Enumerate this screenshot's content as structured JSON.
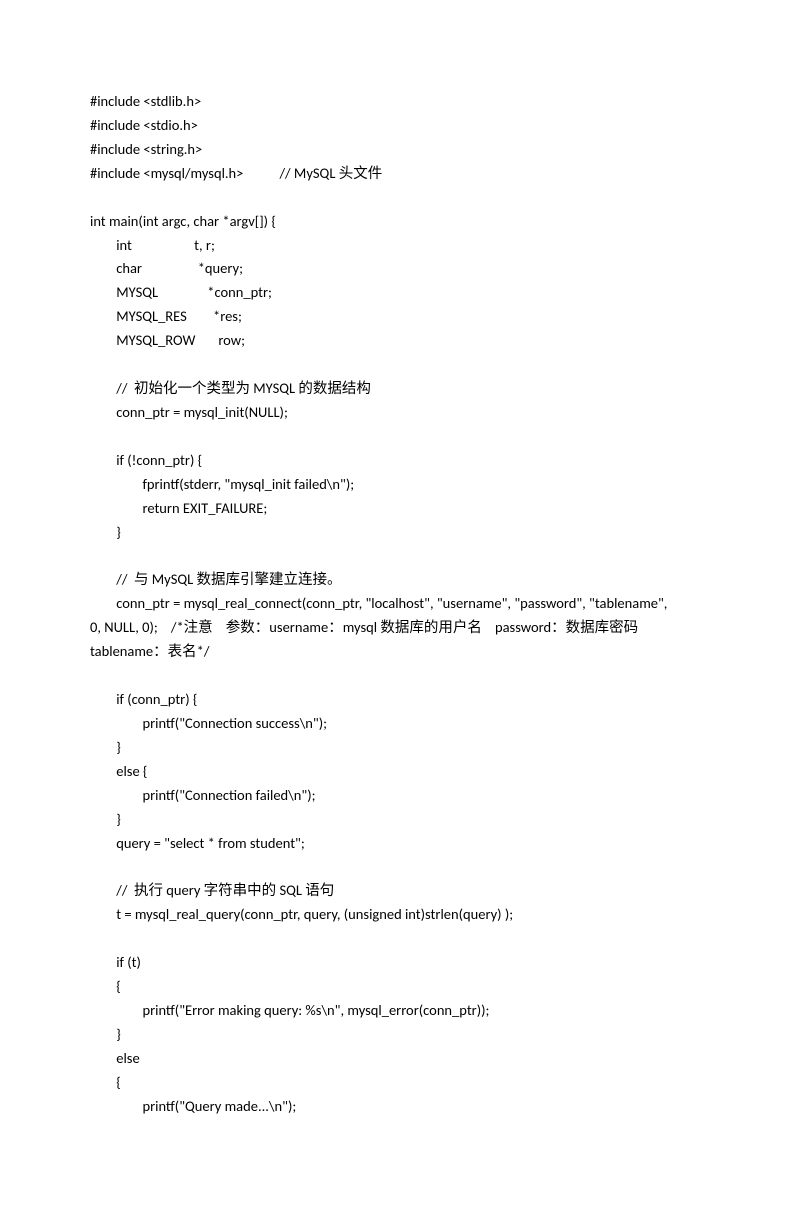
{
  "lines": [
    "#include <stdlib.h>",
    "#include <stdio.h>",
    "#include <string.h>",
    "#include <mysql/mysql.h>           // MySQL 头文件",
    "",
    "int main(int argc, char *argv[]) {",
    "        int                   t, r;",
    "        char                 *query;",
    "        MYSQL               *conn_ptr;",
    "        MYSQL_RES        *res;",
    "        MYSQL_ROW       row;",
    "",
    "        //  初始化一个类型为 MYSQL 的数据结构",
    "        conn_ptr = mysql_init(NULL);",
    "",
    "        if (!conn_ptr) {",
    "                fprintf(stderr, \"mysql_init failed\\n\");",
    "                return EXIT_FAILURE;",
    "        }",
    "",
    "        //  与 MySQL 数据库引擎建立连接。",
    "        conn_ptr = mysql_real_connect(conn_ptr, \"localhost\", \"username\", \"password\", \"tablename\",",
    "0, NULL, 0);    /*注意    参数：username：mysql 数据库的用户名    password：数据库密码",
    "tablename：表名*/",
    "",
    "        if (conn_ptr) {",
    "                printf(\"Connection success\\n\");",
    "        }",
    "        else {",
    "                printf(\"Connection failed\\n\");",
    "        }",
    "        query = \"select * from student\";",
    "",
    "        //  执行 query 字符串中的 SQL 语句",
    "        t = mysql_real_query(conn_ptr, query, (unsigned int)strlen(query) );",
    "",
    "        if (t)",
    "        {",
    "                printf(\"Error making query: %s\\n\", mysql_error(conn_ptr));",
    "        }",
    "        else",
    "        {",
    "                printf(\"Query made...\\n\");"
  ]
}
